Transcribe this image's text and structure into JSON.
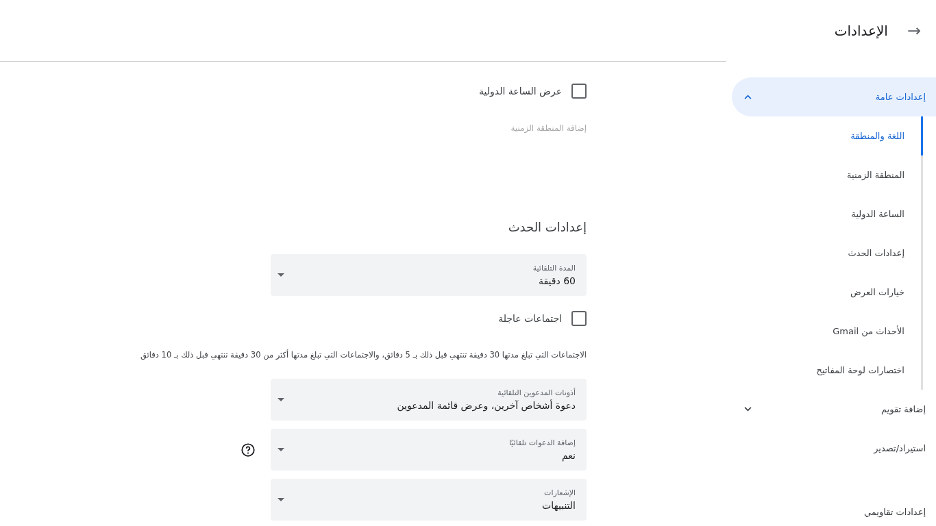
{
  "header": {
    "back_icon": "→",
    "title": "الإعدادات"
  },
  "sidebar": {
    "sections": [
      {
        "label": "إعدادات عامة",
        "expanded": true,
        "selected": true,
        "children": [
          {
            "label": "اللغة والمنطقة",
            "selected": true
          },
          {
            "label": "المنطقة الزمنية",
            "selected": false
          },
          {
            "label": "الساعة الدولية",
            "selected": false
          },
          {
            "label": "إعدادات الحدث",
            "selected": false
          },
          {
            "label": "خيارات العرض",
            "selected": false
          },
          {
            "label": "الأحداث من Gmail",
            "selected": false
          },
          {
            "label": "اختصارات لوحة المفاتيح",
            "selected": false
          }
        ]
      },
      {
        "label": "إضافة تقويم",
        "expanded": false,
        "selected": false
      },
      {
        "label": "استيراد/تصدير",
        "selected": false
      },
      {
        "label": "إعدادات تقاويمي",
        "selected": false
      }
    ]
  },
  "content": [
    {
      "kind": "checkbox",
      "label": "عرض الساعة الدولية",
      "checked": false
    },
    {
      "kind": "link",
      "label": "إضافة المنطقة الزمنية",
      "disabled": true
    },
    {
      "kind": "heading",
      "label": "إعدادات الحدث"
    },
    {
      "kind": "select",
      "label": "المدة التلقائية",
      "value": "60 دقيقة",
      "help": false
    },
    {
      "kind": "checkbox",
      "label": "اجتماعات عاجلة",
      "checked": false
    },
    {
      "kind": "description",
      "label": "الاجتماعات التي تبلغ مدتها 30 دقيقة تنتهي قبل ذلك بـ 5 دقائق، والاجتماعات التي تبلغ مدتها أكثر من 30 دقيقة تنتهي قبل ذلك بـ 10 دقائق"
    },
    {
      "kind": "select",
      "label": "أذونات المدعوين التلقائية",
      "value": "دعوة أشخاص آخرين، وعرض قائمة المدعوين",
      "help": false
    },
    {
      "kind": "select",
      "label": "إضافة الدعوات تلقائيًا",
      "value": "نعم",
      "help": true
    },
    {
      "kind": "select",
      "label": "الإشعارات",
      "value": "التنبيهات",
      "help": false
    }
  ]
}
